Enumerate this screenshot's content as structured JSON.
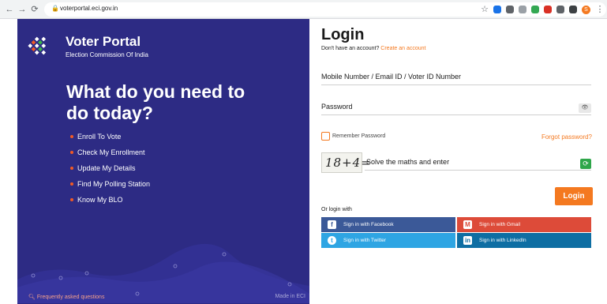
{
  "browser": {
    "url": "voterportal.eci.gov.in",
    "profile_initial": "S"
  },
  "brand": {
    "title": "Voter Portal",
    "subtitle": "Election Commission Of India"
  },
  "hero": {
    "headline": "What do you need to do today?"
  },
  "menu": [
    {
      "label": "Enroll To Vote"
    },
    {
      "label": "Check My Enrollment"
    },
    {
      "label": "Update My Details"
    },
    {
      "label": "Find My Polling Station"
    },
    {
      "label": "Know My BLO"
    }
  ],
  "footer": {
    "faq": "Frequently asked questions",
    "made": "Made in ECI"
  },
  "login": {
    "title": "Login",
    "no_account": "Don't have an account?",
    "create_account": "Create an account",
    "id_field": "Mobile Number / Email ID / Voter ID Number",
    "password_field": "Password",
    "remember": "Remember Password",
    "forgot": "Forgot password?",
    "captcha_image_text": "18+4=",
    "captcha_placeholder": "Solve the maths and enter",
    "submit": "Login",
    "or_login": "Or login with"
  },
  "social": {
    "facebook": "Sign in with Facebook",
    "gmail": "Sign in with Gmail",
    "twitter": "Sign in with Twitter",
    "linkedin": "Sign in with LinkedIn"
  },
  "colors": {
    "panel": "#2d2b84",
    "accent": "#f47920",
    "facebook": "#3b5998",
    "gmail": "#dd4b39",
    "twitter": "#2ea5e3",
    "linkedin": "#0e6ea3"
  },
  "icons": [
    "back-arrow-icon",
    "forward-arrow-icon",
    "reload-icon",
    "lock-icon",
    "star-icon",
    "eye-icon",
    "refresh-icon",
    "search-icon",
    "facebook-icon",
    "gmail-icon",
    "twitter-icon",
    "linkedin-icon"
  ]
}
